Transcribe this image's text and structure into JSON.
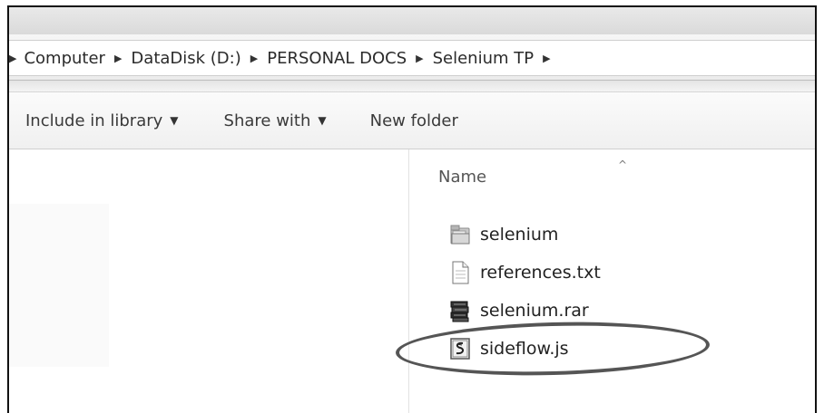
{
  "addressbar": {
    "crumbs": [
      {
        "label": "Computer"
      },
      {
        "label": "DataDisk (D:)"
      },
      {
        "label": "PERSONAL DOCS"
      },
      {
        "label": "Selenium TP"
      }
    ]
  },
  "toolbar": {
    "include_label": "Include in library",
    "share_label": "Share with",
    "newfolder_label": "New folder"
  },
  "columns": {
    "name_header": "Name"
  },
  "files": [
    {
      "name": "selenium",
      "icon": "folder-icon"
    },
    {
      "name": "references.txt",
      "icon": "text-file-icon"
    },
    {
      "name": "selenium.rar",
      "icon": "archive-icon"
    },
    {
      "name": "sideflow.js",
      "icon": "script-file-icon"
    }
  ],
  "annotation": {
    "highlighted_file": "sideflow.js",
    "color": "#555555"
  }
}
